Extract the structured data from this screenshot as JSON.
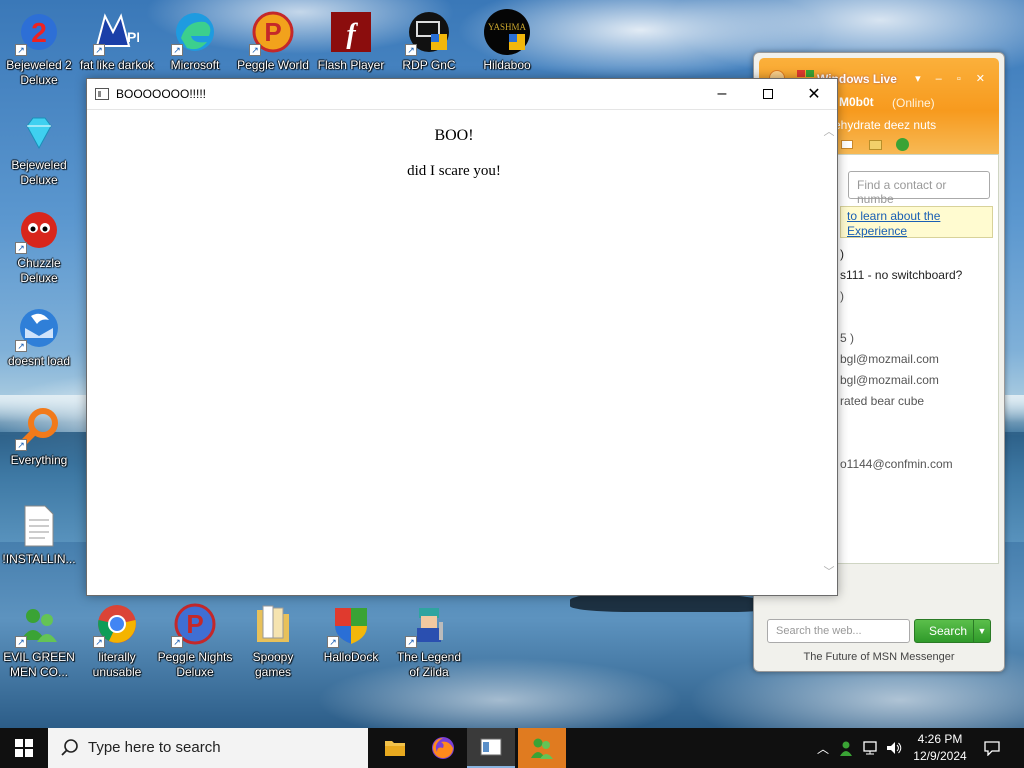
{
  "desktop": {
    "icons": [
      {
        "label": "Bejeweled 2 Deluxe"
      },
      {
        "label": "fat like darkok"
      },
      {
        "label": "Microsoft"
      },
      {
        "label": "Peggle World"
      },
      {
        "label": "Flash Player"
      },
      {
        "label": "RDP GnC"
      },
      {
        "label": "Hildaboo"
      },
      {
        "label": "Bejeweled Deluxe"
      },
      {
        "label": "Chuzzle Deluxe"
      },
      {
        "label": "doesnt load"
      },
      {
        "label": "Everything"
      },
      {
        "label": "!INSTALLIN..."
      },
      {
        "label": "EVIL GREEN MEN CO..."
      },
      {
        "label": "literally unusable"
      },
      {
        "label": "Peggle Nights Deluxe"
      },
      {
        "label": "Spoopy games"
      },
      {
        "label": "HalloDock"
      },
      {
        "label": "The Legend of Zilda"
      }
    ],
    "badge_text": {
      "hildaboo": "YASHMA"
    }
  },
  "browser_window": {
    "title": "BOOOOOOO!!!!!",
    "heading": "BOO!",
    "subtext": "did I scare you!"
  },
  "messenger": {
    "title": "Windows Live",
    "nick": "M0b0t",
    "status": "(Online)",
    "personal_message": "ehydrate deez nuts",
    "find_placeholder": "Find a contact or numbe",
    "banner_line1": "to learn about the",
    "banner_line2": "Experience",
    "contacts": [
      ")",
      "s111 - no switchboard?",
      ")",
      "5 )",
      "bgl@mozmail.com",
      "bgl@mozmail.com",
      "rated bear cube",
      "o1144@confmin.com"
    ],
    "search_placeholder": "Search the web...",
    "search_button": "Search",
    "footer": "The Future of MSN Messenger"
  },
  "taskbar": {
    "search_placeholder": "Type here to search",
    "time": "4:26 PM",
    "date": "12/9/2024"
  },
  "colors": {
    "taskbar": "#101010",
    "msn_orange": "#f79a1e",
    "msn_green": "#2f9a2a",
    "link_blue": "#1a5fb4"
  }
}
